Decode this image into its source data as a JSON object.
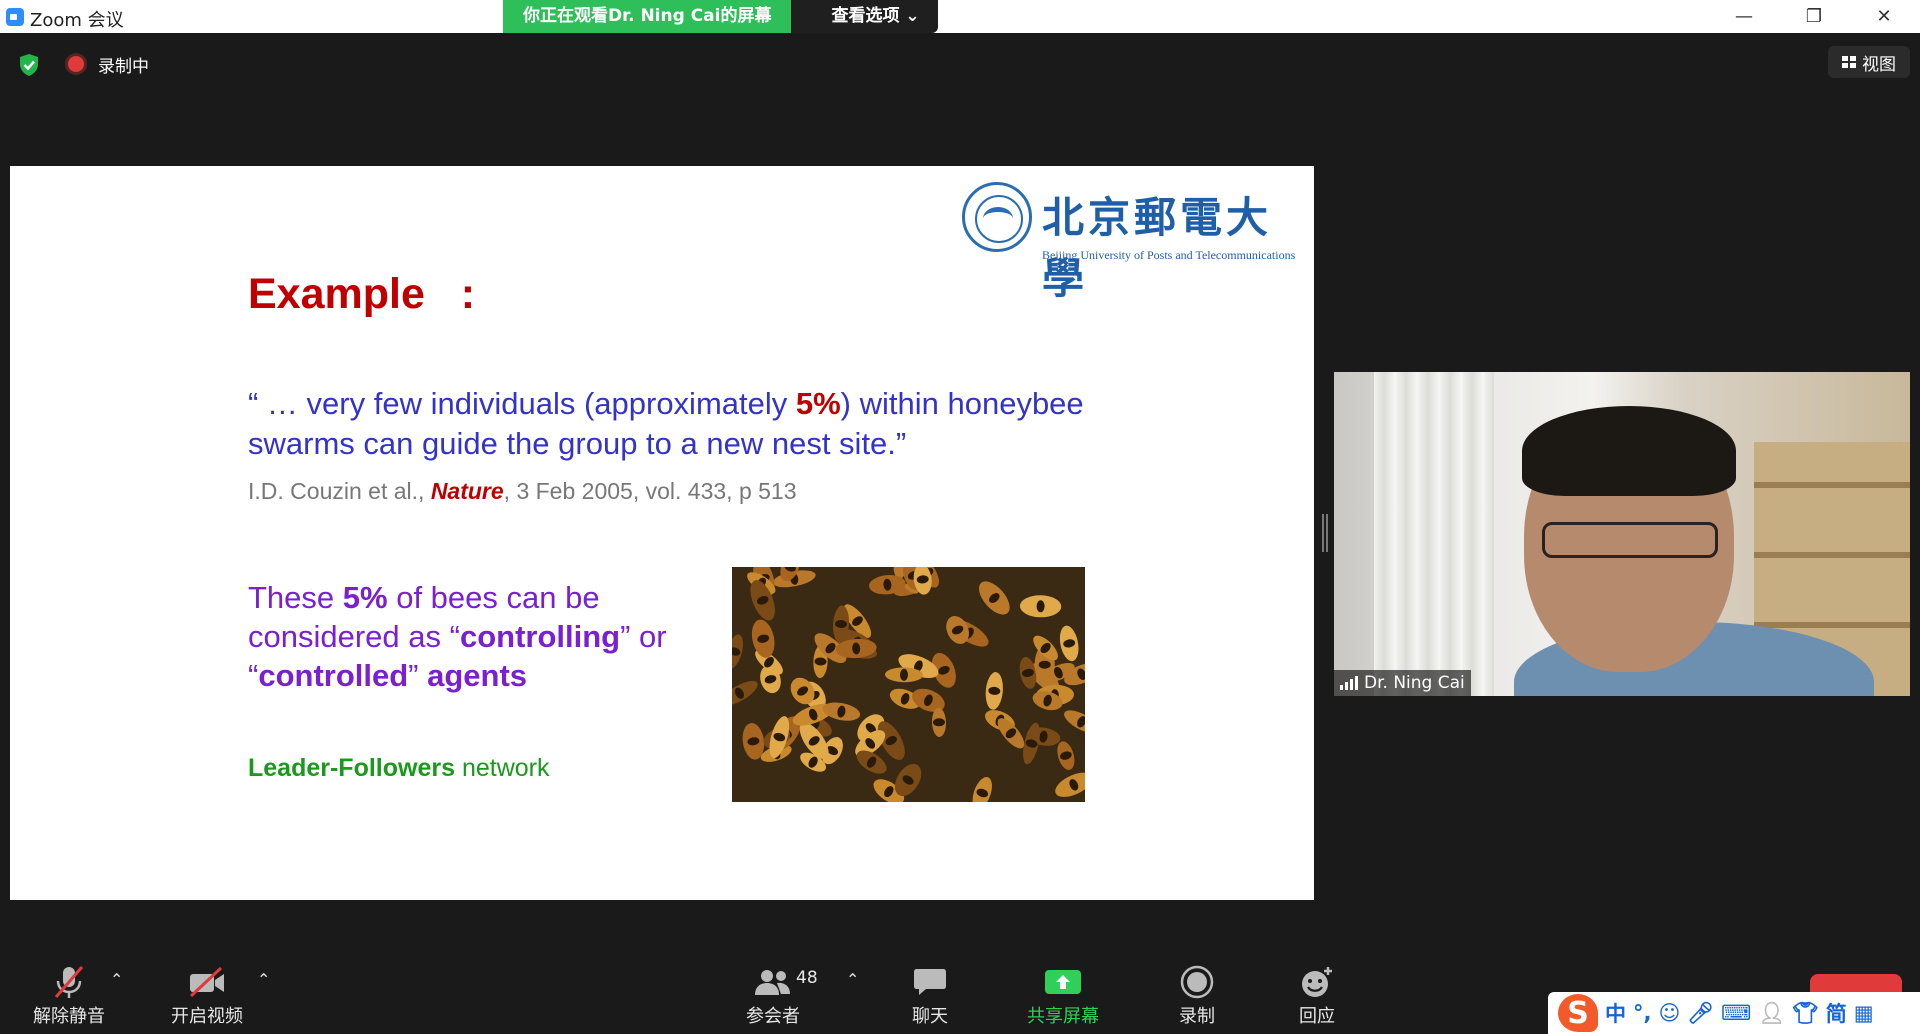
{
  "window": {
    "title": "Zoom 会议",
    "minimize": "—",
    "maximize": "❐",
    "close": "✕"
  },
  "banner": {
    "watching": "你正在观看Dr. Ning Cai的屏幕",
    "options": "查看选项 ⌄"
  },
  "meeting_bar": {
    "recording": "录制中",
    "view": "视图"
  },
  "slide": {
    "logo_cn": "北京郵電大學",
    "logo_en": "Beijing University of Posts and Telecommunications",
    "heading": "Example   :",
    "quote_part1": "   “ … very few individuals (approximately ",
    "quote_highlight": "5%",
    "quote_part2": ") within honeybee swarms can guide the group to a new nest site.”",
    "citation_pre": "I.D. Couzin et al., ",
    "citation_journal": "Nature",
    "citation_post": ", 3 Feb 2005, vol. 433, p 513",
    "bees_1": "These ",
    "bees_2": "5%",
    "bees_3": " of bees can be considered as “",
    "bees_4": "controlling",
    "bees_5": "” or “",
    "bees_6": "controlled",
    "bees_7": "” ",
    "bees_8": "agents",
    "leader_bold": "Leader-Followers",
    "leader_rest": " network"
  },
  "video": {
    "participant_name": "Dr. Ning Cai"
  },
  "toolbar": {
    "unmute": "解除静音",
    "start_video": "开启视频",
    "participants": "参会者",
    "participant_count": "48",
    "chat": "聊天",
    "share_screen": "共享屏幕",
    "record": "录制",
    "reactions": "回应"
  },
  "ime": {
    "logo": "S",
    "lang": "中",
    "punct": "°,",
    "simplified": "简"
  },
  "colors": {
    "accent_green": "#2fcf5a",
    "slide_red": "#c00000",
    "quote_blue": "#3333cc",
    "purple": "#7a1fd1",
    "leader_green": "#1a9a1a"
  }
}
